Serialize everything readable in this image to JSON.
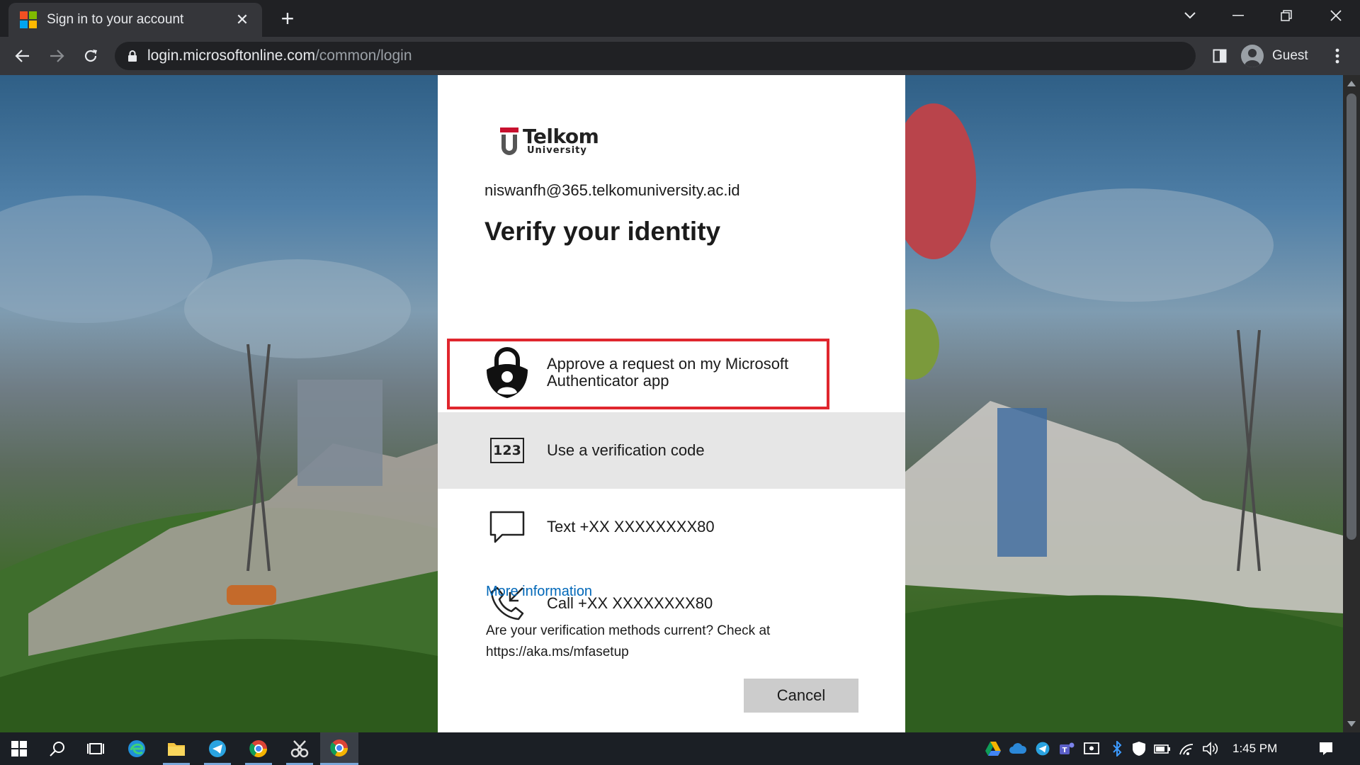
{
  "browser": {
    "tab_title": "Sign in to your account",
    "url_host": "login.microsoftonline.com",
    "url_path": "/common/login",
    "profile_label": "Guest"
  },
  "page": {
    "org_logo_text": "Telkom",
    "org_logo_subtext": "University",
    "account_email": "niswanfh@365.telkomuniversity.ac.id",
    "heading": "Verify your identity",
    "options": [
      {
        "label": "Approve a request on my Microsoft Authenticator app",
        "icon": "authenticator-lock-icon"
      },
      {
        "label": "Use a verification code",
        "icon": "verification-code-icon",
        "icon_text": "123"
      },
      {
        "label": "Text +XX XXXXXXXX80",
        "icon": "chat-bubble-icon"
      },
      {
        "label": "Call +XX XXXXXXXX80",
        "icon": "phone-call-icon"
      }
    ],
    "more_info_link": "More information",
    "check_text": "Are your verification methods current? Check at https://aka.ms/mfasetup",
    "cancel_label": "Cancel"
  },
  "taskbar": {
    "time": "1:45 PM"
  },
  "colors": {
    "link": "#0067b8",
    "highlight": "#e0262e",
    "selected_row": "#e6e6e6",
    "logo_red": "#c8102e"
  }
}
